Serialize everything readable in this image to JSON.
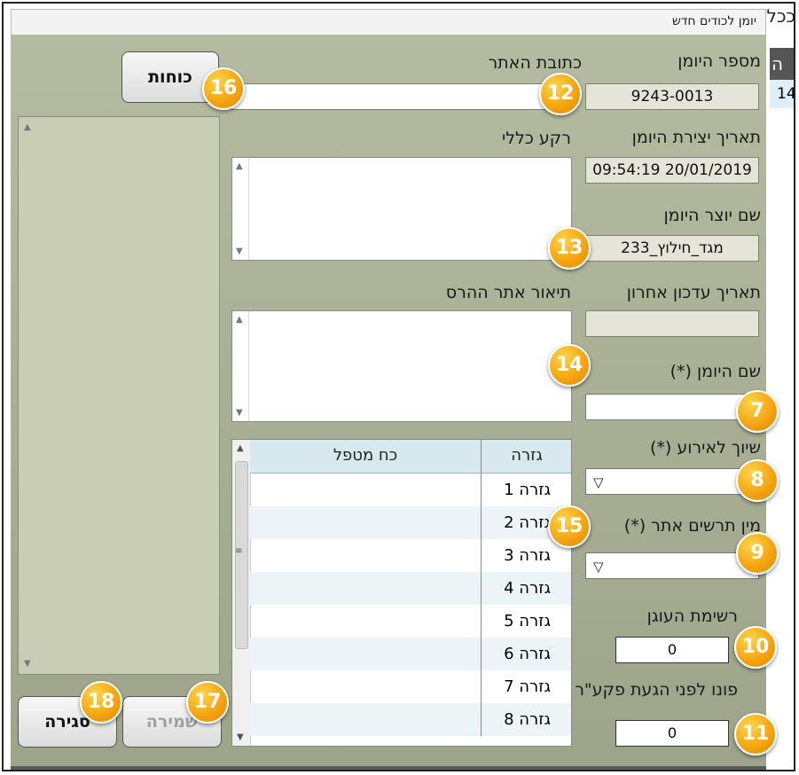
{
  "window": {
    "title": "יומן לכודים חדש"
  },
  "background": {
    "corner_text": "ככל",
    "header_text": "ה",
    "row_text": "14"
  },
  "fields": {
    "journal_number": {
      "label": "מספר היומן",
      "value": "9243-0013"
    },
    "site_address": {
      "label": "כתובת האתר",
      "value": ""
    },
    "created_date": {
      "label": "תאריך יצירת היומן",
      "value": "09:54:19 20/01/2019"
    },
    "general_background": {
      "label": "רקע כללי",
      "value": ""
    },
    "creator_name": {
      "label": "שם יוצר היומן",
      "value": "מגד_חילוץ_233"
    },
    "last_update": {
      "label": "תאריך עדכון אחרון",
      "value": ""
    },
    "site_description": {
      "label": "תיאור אתר ההרס",
      "value": ""
    },
    "journal_name": {
      "label": "שם היומן (*)",
      "value": ""
    },
    "event_link": {
      "label": "שיוך לאירוע (*)"
    },
    "site_scenario": {
      "label": "מין תרשים אתר (*)"
    },
    "anchor_list": {
      "label": "רשימת העוגן",
      "value": "0"
    },
    "evacuated_before": {
      "label": "פונו לפני הגעת פקע\"ר",
      "value": "0"
    }
  },
  "forces_grid": {
    "headers": [
      "גזרה",
      "כח מטפל"
    ],
    "rows": [
      "גזרה 1",
      "גזרה 2",
      "גזרה 3",
      "גזרה 4",
      "גזרה 5",
      "גזרה 6",
      "גזרה 7",
      "גזרה 8"
    ]
  },
  "buttons": {
    "forces": "כוחות",
    "save": "שמירה",
    "close": "סגירה"
  },
  "badges": [
    "16",
    "12",
    "13",
    "14",
    "7",
    "8",
    "9",
    "10",
    "11",
    "15",
    "17",
    "18"
  ],
  "icons": {
    "dropdown": "▽",
    "scroll_up": "▲",
    "scroll_down": "▼",
    "grip": "≡"
  },
  "colors": {
    "panel": "#a8ae94",
    "grid_header": "#d7e9ee",
    "badge": "#f3a10f"
  }
}
